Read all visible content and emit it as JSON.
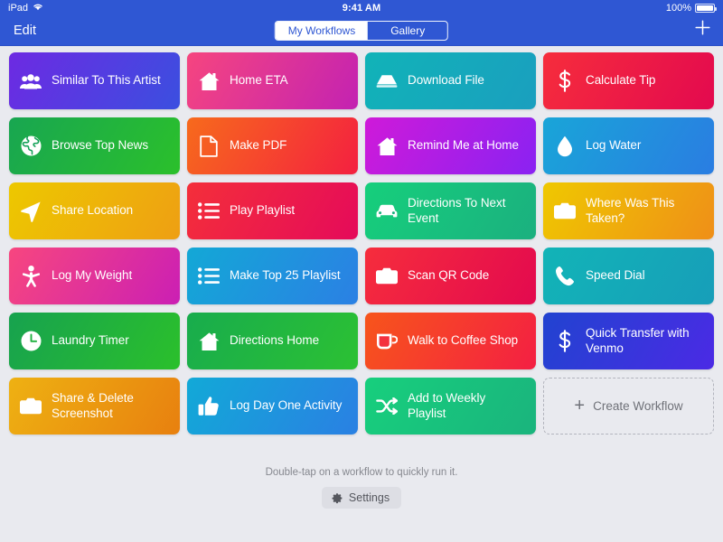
{
  "status_bar": {
    "device": "iPad",
    "wifi_icon": "wifi-icon",
    "time": "9:41 AM",
    "battery_percent": "100%",
    "battery_icon": "battery-full-icon"
  },
  "nav_bar": {
    "edit_label": "Edit",
    "add_icon": "plus-icon",
    "background_color": "#2f57d3",
    "segments": [
      {
        "label": "My Workflows",
        "selected": true
      },
      {
        "label": "Gallery",
        "selected": false
      }
    ]
  },
  "workflows": [
    {
      "label": "Similar To This Artist",
      "icon": "people-icon",
      "gradient_from": "#6d2ae2",
      "gradient_to": "#3b4fe0"
    },
    {
      "label": "Home ETA",
      "icon": "house-icon",
      "gradient_from": "#f6457f",
      "gradient_to": "#c322b2"
    },
    {
      "label": "Download File",
      "icon": "disk-icon",
      "gradient_from": "#11b3b8",
      "gradient_to": "#1a9fbf"
    },
    {
      "label": "Calculate Tip",
      "icon": "dollar-icon",
      "gradient_from": "#f62d3c",
      "gradient_to": "#e3094f"
    },
    {
      "label": "Browse Top News",
      "icon": "globe-icon",
      "gradient_from": "#18a651",
      "gradient_to": "#2bc02b"
    },
    {
      "label": "Make PDF",
      "icon": "document-icon",
      "gradient_from": "#f76a1c",
      "gradient_to": "#f42040"
    },
    {
      "label": "Remind Me at Home",
      "icon": "house-icon",
      "gradient_from": "#cf1ad9",
      "gradient_to": "#8a22f2"
    },
    {
      "label": "Log Water",
      "icon": "droplet-icon",
      "gradient_from": "#19a5d8",
      "gradient_to": "#2a7de2"
    },
    {
      "label": "Share Location",
      "icon": "navigation-arrow-icon",
      "gradient_from": "#edc800",
      "gradient_to": "#ee9f13"
    },
    {
      "label": "Play Playlist",
      "icon": "list-icon",
      "gradient_from": "#f42f3a",
      "gradient_to": "#e50a5a"
    },
    {
      "label": "Directions To Next Event",
      "icon": "car-icon",
      "gradient_from": "#16cf7c",
      "gradient_to": "#1bb07f"
    },
    {
      "label": "Where Was This Taken?",
      "icon": "camera-icon",
      "gradient_from": "#efc800",
      "gradient_to": "#ef8f18"
    },
    {
      "label": "Log My Weight",
      "icon": "person-icon",
      "gradient_from": "#f7467f",
      "gradient_to": "#cb1fb4"
    },
    {
      "label": "Make Top 25 Playlist",
      "icon": "list-icon",
      "gradient_from": "#13a8d6",
      "gradient_to": "#2b80e4"
    },
    {
      "label": "Scan QR Code",
      "icon": "camera-icon",
      "gradient_from": "#f62d3c",
      "gradient_to": "#e3094f"
    },
    {
      "label": "Speed Dial",
      "icon": "phone-icon",
      "gradient_from": "#12b4b7",
      "gradient_to": "#179eb9"
    },
    {
      "label": "Laundry Timer",
      "icon": "clock-icon",
      "gradient_from": "#17a24f",
      "gradient_to": "#2bc02b"
    },
    {
      "label": "Directions Home",
      "icon": "house-icon",
      "gradient_from": "#18ac4d",
      "gradient_to": "#2cc133"
    },
    {
      "label": "Walk to Coffee Shop",
      "icon": "cup-icon",
      "gradient_from": "#f7551b",
      "gradient_to": "#f41f43"
    },
    {
      "label": "Quick Transfer with Venmo",
      "icon": "dollar-icon",
      "gradient_from": "#2143d0",
      "gradient_to": "#4b2ae5"
    },
    {
      "label": "Share & Delete Screenshot",
      "icon": "camera-icon",
      "gradient_from": "#eeb112",
      "gradient_to": "#e8800f"
    },
    {
      "label": "Log Day One Activity",
      "icon": "thumbs-up-icon",
      "gradient_from": "#12a9d7",
      "gradient_to": "#2a80e3"
    },
    {
      "label": "Add to Weekly Playlist",
      "icon": "shuffle-icon",
      "gradient_from": "#17cf7d",
      "gradient_to": "#1ab47d"
    }
  ],
  "create_workflow": {
    "label": "Create Workflow",
    "icon": "plus-icon"
  },
  "footer": {
    "hint": "Double-tap on a workflow to quickly run it.",
    "settings_label": "Settings",
    "settings_icon": "gear-icon"
  }
}
